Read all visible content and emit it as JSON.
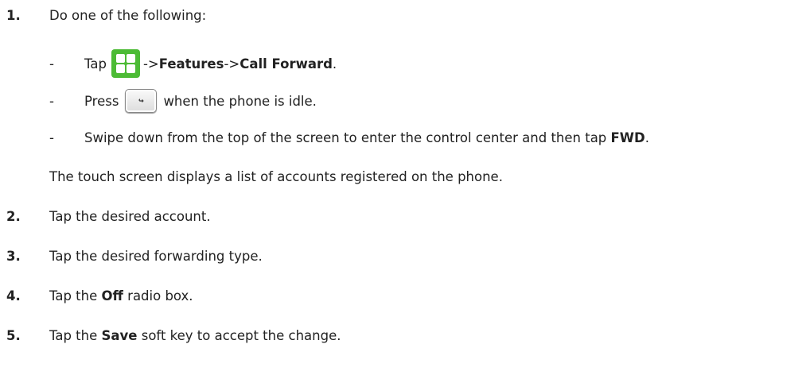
{
  "steps": [
    {
      "num": "1.",
      "text": "Do one of the following:"
    },
    {
      "num": "2.",
      "text": "Tap the desired account."
    },
    {
      "num": "3.",
      "text": "Tap the desired forwarding type."
    },
    {
      "num": "4.",
      "pre": "Tap the ",
      "bold": "Off",
      "post": " radio box."
    },
    {
      "num": "5.",
      "pre": "Tap the ",
      "bold": "Save",
      "post": " soft key to accept the change."
    }
  ],
  "options": [
    {
      "dash": "-",
      "pre": "Tap",
      "arrow1": "->",
      "bold1": "Features",
      "arrow2": "->",
      "bold2": "Call Forward",
      "end": ".",
      "icon": "menu-grid-icon"
    },
    {
      "dash": "-",
      "pre": "Press",
      "post": "when the phone is idle.",
      "icon": "forward-key-icon",
      "key_glyph": "↪"
    },
    {
      "dash": "-",
      "pre": "Swipe down from the top of the screen to enter the control center and then tap ",
      "bold": "FWD",
      "end": "."
    }
  ],
  "result_text": "The touch screen displays a list of accounts registered on the phone.",
  "colors": {
    "menu_icon": "#4cbb35"
  }
}
